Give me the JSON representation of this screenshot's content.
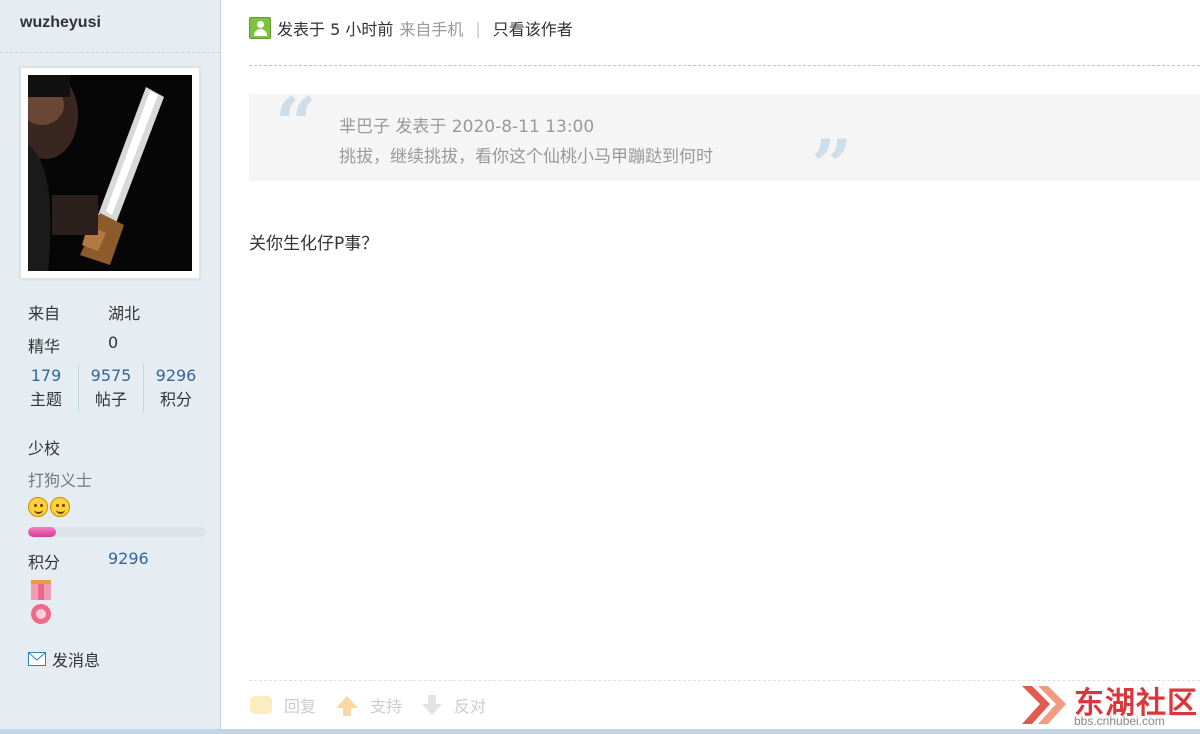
{
  "sidebar": {
    "username": "wuzheyusi",
    "from_label": "来自",
    "from_value": "湖北",
    "digest_label": "精华",
    "digest_value": "0",
    "stats": [
      {
        "value": "179",
        "label": "主题"
      },
      {
        "value": "9575",
        "label": "帖子"
      },
      {
        "value": "9296",
        "label": "积分"
      }
    ],
    "rank": "少校",
    "custom_title": "打狗义士",
    "level_progress": 0.16,
    "points_label": "积分",
    "points_value": "9296",
    "message_label": "发消息"
  },
  "post": {
    "meta_posted": "发表于 5 小时前",
    "meta_from": "来自手机",
    "meta_sep": "|",
    "only_author": "只看该作者",
    "quote_header": "芈巴子 发表于 2020-8-11 13:00",
    "quote_body": "挑拔，继续挑拔，看你这个仙桃小马甲蹦跶到何时",
    "quote_open": "“",
    "quote_close": "”",
    "content": "关你生化仔P事？"
  },
  "actions": {
    "reply": "回复",
    "support": "支持",
    "oppose": "反对"
  },
  "watermark": {
    "name": "东湖社区",
    "url": "bbs.cnhubei.com"
  },
  "colors": {
    "sidebar_bg": "#e5edf2",
    "link_blue": "#336699",
    "progress_pink": "#e052a8",
    "brand_red": "#d9373b"
  }
}
